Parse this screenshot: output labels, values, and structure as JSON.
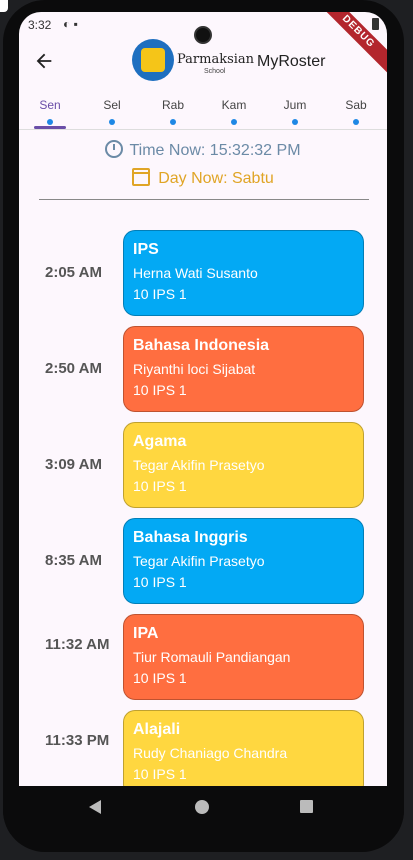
{
  "status": {
    "time": "3:32",
    "icons": "◐ ▪"
  },
  "debug_banner": "DEBUG",
  "appbar": {
    "school_name": "Parmaksian",
    "school_sub": "School",
    "title": "MyRoster"
  },
  "tabs": [
    {
      "label": "Sen",
      "active": true
    },
    {
      "label": "Sel",
      "active": false
    },
    {
      "label": "Rab",
      "active": false
    },
    {
      "label": "Kam",
      "active": false
    },
    {
      "label": "Jum",
      "active": false
    },
    {
      "label": "Sab",
      "active": false
    }
  ],
  "info": {
    "time_now": "Time Now: 15:32:32 PM",
    "day_now": "Day Now: Sabtu"
  },
  "schedule": [
    {
      "time": "2:05 AM",
      "subject": "IPS",
      "teacher": "Herna Wati Susanto",
      "class": "10 IPS 1",
      "color": "#03a9f4",
      "text_color": "#ffffff"
    },
    {
      "time": "2:50 AM",
      "subject": "Bahasa Indonesia",
      "teacher": "Riyanthi loci Sijabat",
      "class": "10 IPS 1",
      "color": "#ff6e40",
      "text_color": "#ffffff"
    },
    {
      "time": "3:09 AM",
      "subject": "Agama",
      "teacher": "Tegar Akifin Prasetyo",
      "class": "10 IPS 1",
      "color": "#ffd740",
      "text_color": "#ffffff"
    },
    {
      "time": "8:35 AM",
      "subject": "Bahasa Inggris",
      "teacher": "Tegar Akifin Prasetyo",
      "class": "10 IPS 1",
      "color": "#03a9f4",
      "text_color": "#ffffff"
    },
    {
      "time": "11:32 AM",
      "subject": "IPA",
      "teacher": "Tiur Romauli Pandiangan",
      "class": "10 IPS 1",
      "color": "#ff6e40",
      "text_color": "#ffffff"
    },
    {
      "time": "11:33 PM",
      "subject": "Alajali",
      "teacher": "Rudy Chaniago Chandra",
      "class": "10 IPS 1",
      "color": "#ffd740",
      "text_color": "#ffffff"
    }
  ]
}
